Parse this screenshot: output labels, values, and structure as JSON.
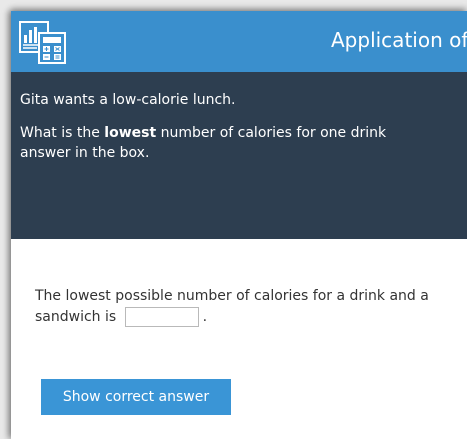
{
  "header": {
    "title": "Application of",
    "icon": "chart-calculator-icon"
  },
  "question": {
    "line1": "Gita wants a low-calorie lunch.",
    "line2_prefix": "What is the ",
    "line2_bold": "lowest",
    "line2_suffix": " number of calories for one drink",
    "line3": "answer in the box."
  },
  "answer": {
    "text_before": "The lowest possible number of calories for a drink and a sandwich is",
    "text_after": ".",
    "input_value": ""
  },
  "button": {
    "label": "Show correct answer"
  },
  "colors": {
    "header": "#3a8fcd",
    "question_bg": "#2d3e50",
    "button": "#3a95d6"
  }
}
